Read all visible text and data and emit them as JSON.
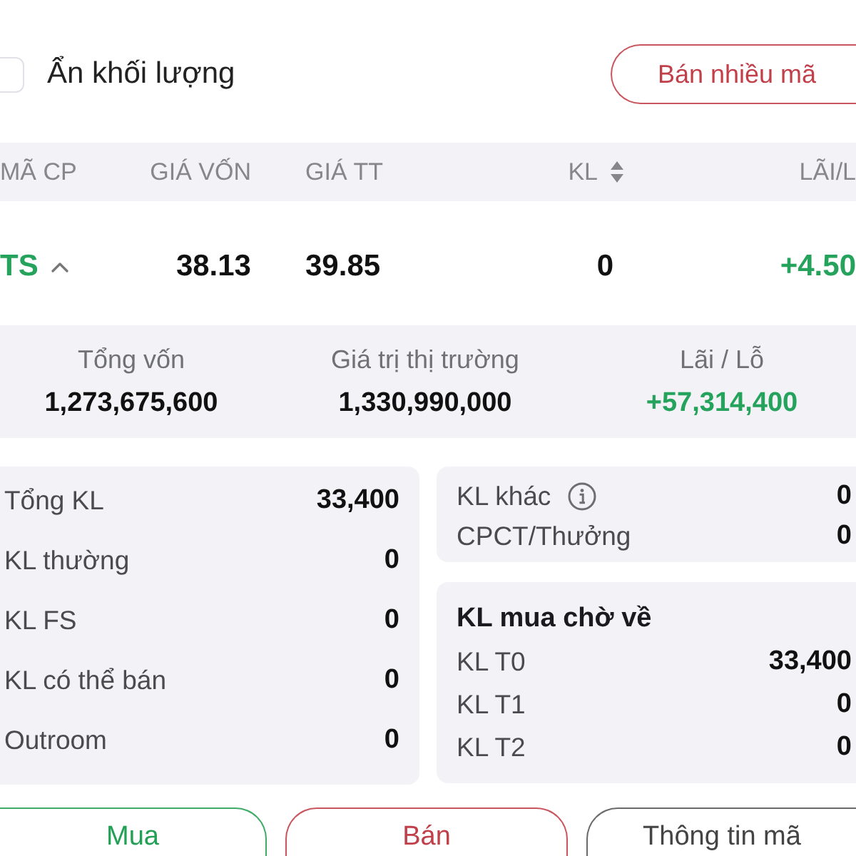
{
  "hide_volume": {
    "label": "Ẩn khối lượng",
    "checked": false
  },
  "sell_multiple_button": {
    "label": "Bán nhiều mã"
  },
  "table": {
    "columns": [
      {
        "label": "MÃ CP",
        "sortable": false
      },
      {
        "label": "GIÁ VỐN",
        "sortable": false
      },
      {
        "label": "GIÁ TT",
        "sortable": false
      },
      {
        "label": "KL",
        "sortable": true
      },
      {
        "label": "LÃI/L",
        "sortable": false
      }
    ],
    "rows": [
      {
        "symbol": "TS",
        "expanded": true,
        "positive": true,
        "cost": "38.13",
        "price": "39.85",
        "volume": "0",
        "profit": "+4.50"
      }
    ]
  },
  "summary": [
    {
      "label": "Tổng vốn",
      "value": "1,273,675,600",
      "kind": "amount"
    },
    {
      "label": "Giá trị thị trường",
      "value": "1,330,990,000",
      "kind": "amount"
    },
    {
      "label": "Lãi / Lỗ",
      "value": "+57,314,400",
      "kind": "gain"
    }
  ],
  "volume_breakdown": [
    {
      "label": "Tổng KL",
      "value": "33,400"
    },
    {
      "label": "KL thường",
      "value": "0"
    },
    {
      "label": "KL FS",
      "value": "0"
    },
    {
      "label": "KL có thể bán",
      "value": "0"
    },
    {
      "label": "Outroom",
      "value": "0"
    }
  ],
  "other_volume": [
    {
      "label": "KL khác",
      "value": "0",
      "info": true
    },
    {
      "label": "CPCT/Thưởng",
      "value": "0",
      "info": false
    }
  ],
  "pending_volume": {
    "title": "KL mua chờ về",
    "items": [
      {
        "label": "KL T0",
        "value": "33,400"
      },
      {
        "label": "KL T1",
        "value": "0"
      },
      {
        "label": "KL T2",
        "value": "0"
      }
    ]
  },
  "actions": [
    {
      "label": "Mua",
      "kind": "buy"
    },
    {
      "label": "Bán",
      "kind": "sell"
    },
    {
      "label": "Thông tin mã",
      "kind": "info"
    }
  ]
}
